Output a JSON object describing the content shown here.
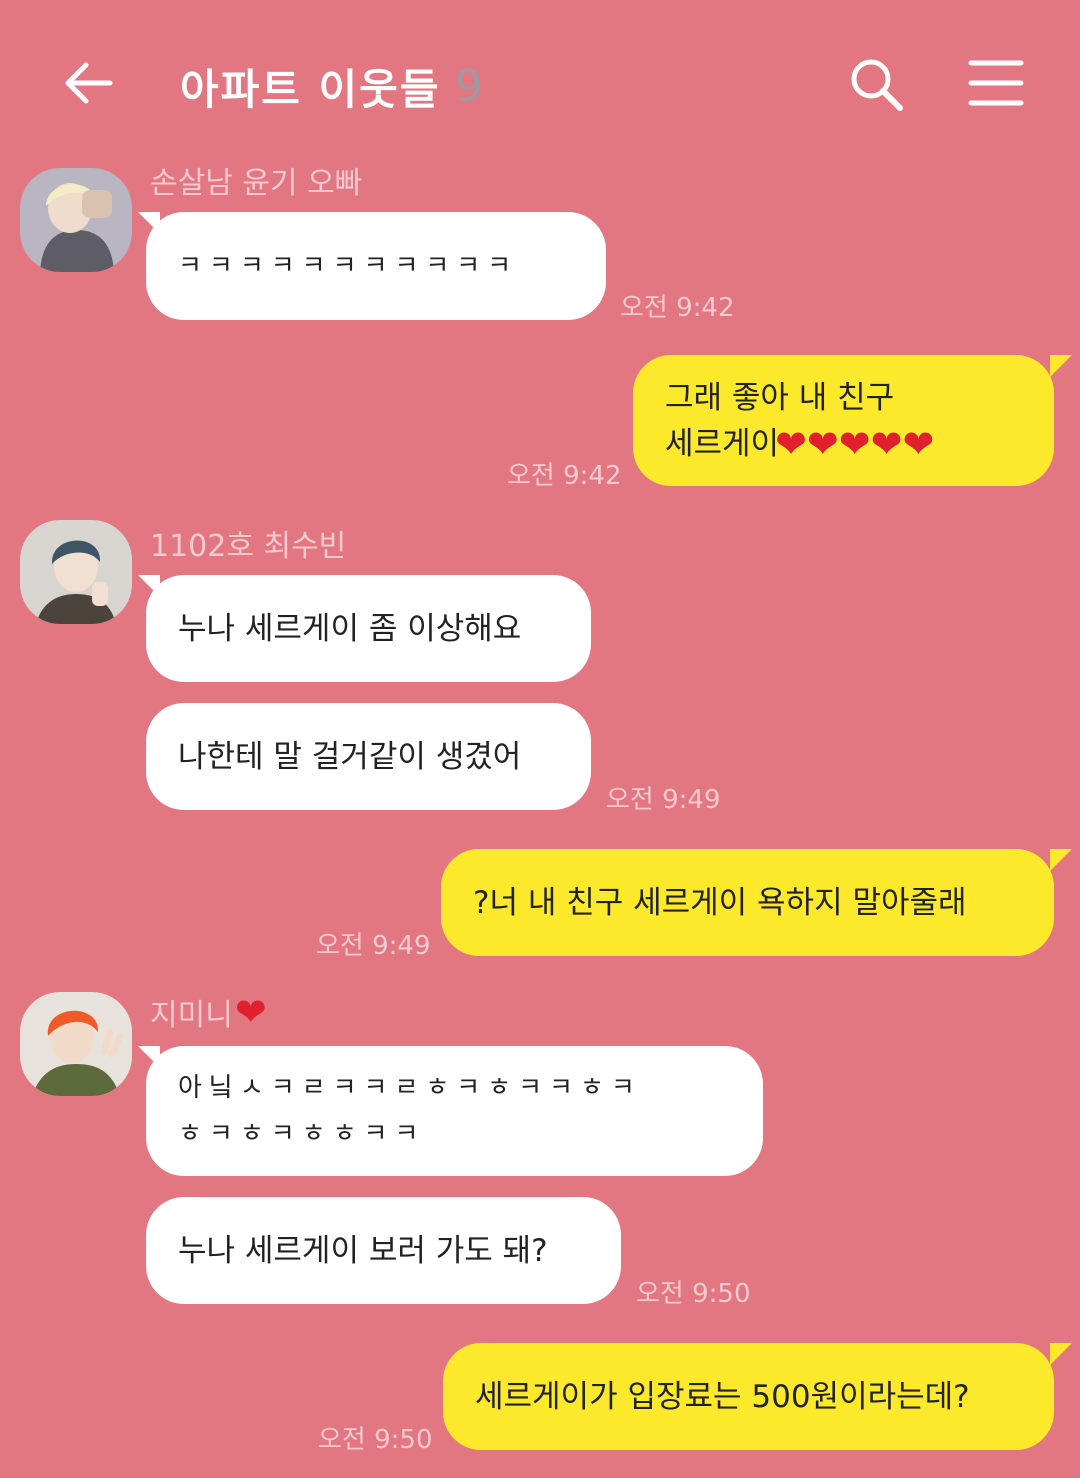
{
  "header": {
    "title": "아파트 이웃들",
    "member_count": "9"
  },
  "colors": {
    "background": "#e27782",
    "incoming_bubble": "#ffffff",
    "outgoing_bubble": "#fde92c",
    "meta_text": "#f6c9cf"
  },
  "icons": {
    "back": "arrow-left-icon",
    "search": "search-icon",
    "menu": "hamburger-menu-icon",
    "heart": "❤"
  },
  "messages": {
    "m1": {
      "sender": "손살남 윤기 오빠",
      "text": "ㅋㅋㅋㅋㅋㅋㅋㅋㅋㅋㅋ",
      "time": "오전 9:42"
    },
    "m2": {
      "line1": "그래 좋아 내 친구",
      "line2": "세르게이",
      "time": "오전 9:42"
    },
    "m3": {
      "sender": "1102호 최수빈",
      "text1": "누나 세르게이 좀 이상해요",
      "text2": "나한테 말 걸거같이 생겼어",
      "time": "오전 9:49"
    },
    "m4": {
      "text": "?너 내 친구 세르게이 욕하지 말아줄래",
      "time": "오전 9:49"
    },
    "m5": {
      "sender": "지미니",
      "line1": "아닠ㅅㅋㄹㅋㅋㄹㅎㅋㅎㅋㅋㅎㅋ",
      "line2": "ㅎㅋㅎㅋㅎㅎㅋㅋ",
      "text2": "누나 세르게이 보러 가도 돼?",
      "time": "오전 9:50"
    },
    "m6": {
      "text": "세르게이가 입장료는 500원이라는데?",
      "time": "오전 9:50"
    }
  }
}
